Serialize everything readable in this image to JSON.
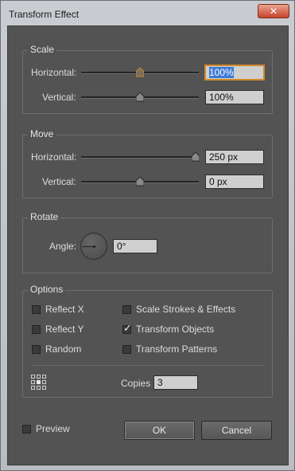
{
  "window": {
    "title": "Transform Effect",
    "close_glyph": "✕"
  },
  "scale": {
    "group_label": "Scale",
    "horizontal_label": "Horizontal:",
    "horizontal_value": "100%",
    "vertical_label": "Vertical:",
    "vertical_value": "100%"
  },
  "move": {
    "group_label": "Move",
    "horizontal_label": "Horizontal:",
    "horizontal_value": "250 px",
    "vertical_label": "Vertical:",
    "vertical_value": "0 px"
  },
  "rotate": {
    "group_label": "Rotate",
    "angle_label": "Angle:",
    "angle_value": "0°"
  },
  "options": {
    "group_label": "Options",
    "reflect_x": {
      "label": "Reflect X",
      "checked": false
    },
    "reflect_y": {
      "label": "Reflect Y",
      "checked": false
    },
    "random": {
      "label": "Random",
      "checked": false
    },
    "scale_strokes": {
      "label": "Scale Strokes & Effects",
      "checked": false
    },
    "transform_objects": {
      "label": "Transform Objects",
      "checked": true
    },
    "transform_patterns": {
      "label": "Transform Patterns",
      "checked": false
    },
    "copies_label": "Copies",
    "copies_value": "3",
    "reference_point_icon": "reference-point-grid"
  },
  "footer": {
    "preview": {
      "label": "Preview",
      "checked": false
    },
    "ok_label": "OK",
    "cancel_label": "Cancel"
  },
  "check_glyph": "✓",
  "colors": {
    "panel": "#535353",
    "focus": "#d08a2c",
    "selection": "#3d7bd6"
  }
}
